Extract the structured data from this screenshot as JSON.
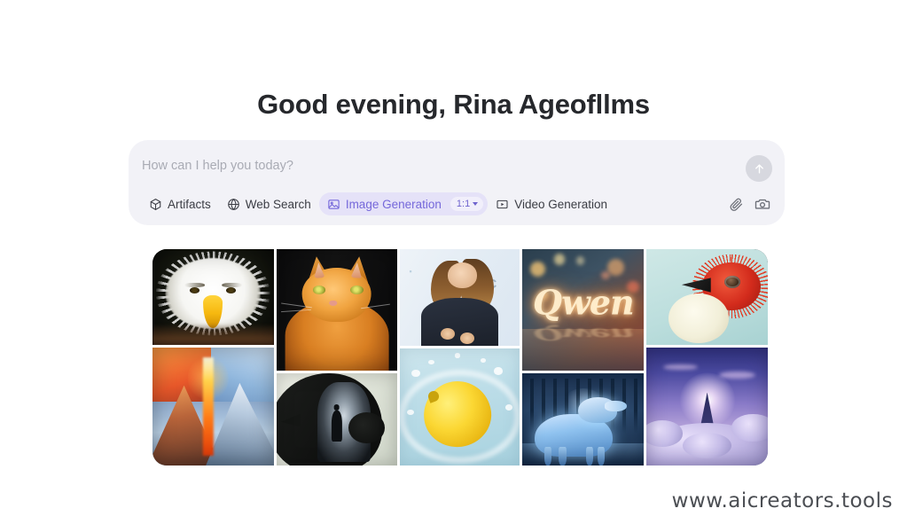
{
  "greeting": "Good evening, Rina Ageofllms",
  "composer": {
    "placeholder": "How can I help you today?",
    "value": "",
    "send_icon": "arrow-up-icon",
    "tools": [
      {
        "label": "Artifacts",
        "icon": "cube-icon",
        "active": false
      },
      {
        "label": "Web Search",
        "icon": "globe-icon",
        "active": false
      },
      {
        "label": "Image Generation",
        "icon": "image-icon",
        "active": true,
        "ratio": "1:1"
      },
      {
        "label": "Video Generation",
        "icon": "video-play-icon",
        "active": false
      }
    ],
    "right_icons": [
      {
        "name": "paperclip-icon"
      },
      {
        "name": "camera-icon"
      }
    ]
  },
  "gallery": {
    "columns": [
      {
        "cells": [
          {
            "alt": "bald eagle close-up portrait with white feathers and yellow beak"
          },
          {
            "alt": "split volcano mountain, fire on left and snow on right"
          }
        ]
      },
      {
        "cells": [
          {
            "alt": "orange tabby cat portrait on dark background"
          },
          {
            "alt": "silhouette of a woman's profile containing a figure walking in a tunnel"
          }
        ]
      },
      {
        "cells": [
          {
            "alt": "smiling woman speaking on stage with presentation screen"
          },
          {
            "alt": "yellow lemon splashing into water"
          }
        ]
      },
      {
        "cells": [
          {
            "alt": "glowing ice letters spelling Qwen with bokeh lights"
          },
          {
            "alt": "glowing blue wolf standing in a winter forest stream"
          }
        ]
      },
      {
        "cells": [
          {
            "alt": "red spiky bird with cream belly on pale teal background"
          },
          {
            "alt": "celestial mountain peak above purple clouds with bright light"
          }
        ]
      }
    ]
  },
  "watermark": "www.aicreators.tools",
  "colors": {
    "accent_purple": "#7568da",
    "accent_pill_bg": "#e5e2f8",
    "composer_bg": "#f2f2f7",
    "text_primary": "#26282c",
    "placeholder": "#a9abb4",
    "page_bg": "#ffffff"
  }
}
